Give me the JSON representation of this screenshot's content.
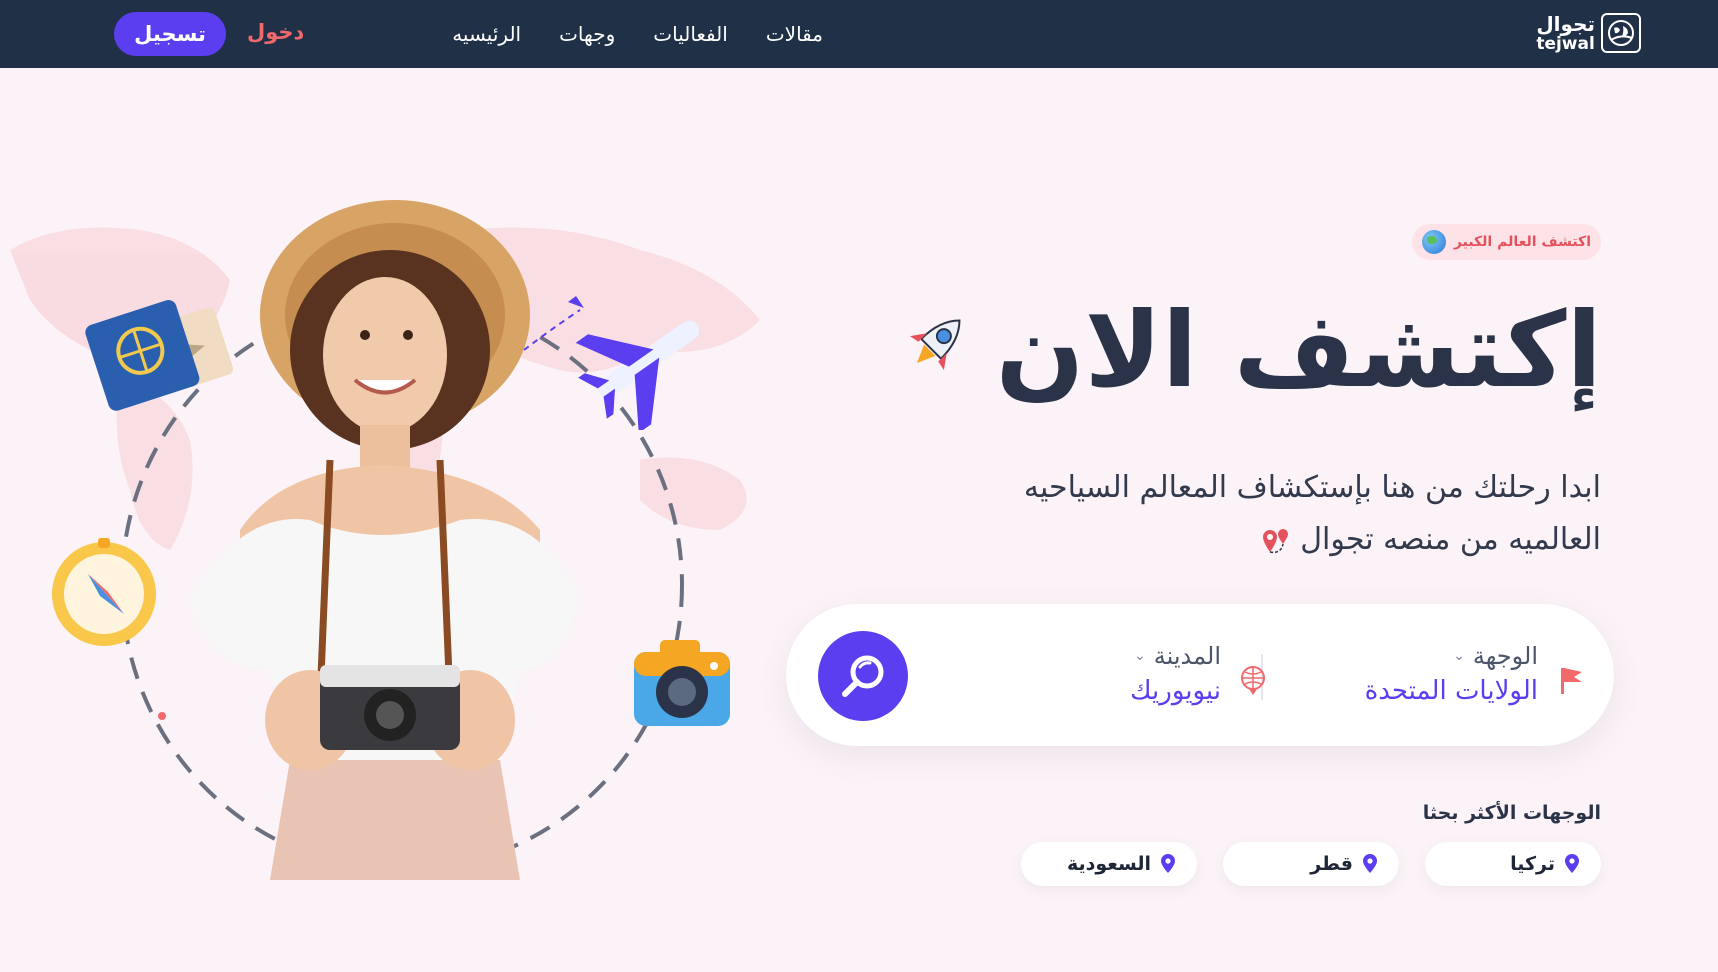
{
  "logo": {
    "ar": "تجوال",
    "en": "tejwal"
  },
  "nav": {
    "links": [
      "الرئيسيه",
      "وجهات",
      "الفعاليات",
      "مقالات"
    ],
    "login": "دخول",
    "signup": "تسجيل"
  },
  "hero": {
    "badge": "اكتشف العالم الكبير",
    "title": "إكتشف الان",
    "subtitle_line1": "ابدا رحلتك من هنا بإستكشاف المعالم السياحيه",
    "subtitle_line2": "العالميه من منصه تجوال"
  },
  "search": {
    "destination_label": "الوجهة",
    "destination_value": "الولايات المتحدة",
    "city_label": "المدينة",
    "city_value": "نيويوريك"
  },
  "popular": {
    "title": "الوجهات الأكثر بحثا",
    "items": [
      "تركيا",
      "قطر",
      "السعودية"
    ]
  },
  "colors": {
    "navbar": "#1f3047",
    "accent": "#5b3ef0",
    "login": "#f2696b",
    "background": "#fbf3f7"
  },
  "icons": [
    "globe-icon",
    "rocket-icon",
    "map-pin-icon",
    "flag-icon",
    "search-icon",
    "location-pin-icon",
    "passport-icon",
    "airplane-icon",
    "compass-icon",
    "camera-icon"
  ]
}
